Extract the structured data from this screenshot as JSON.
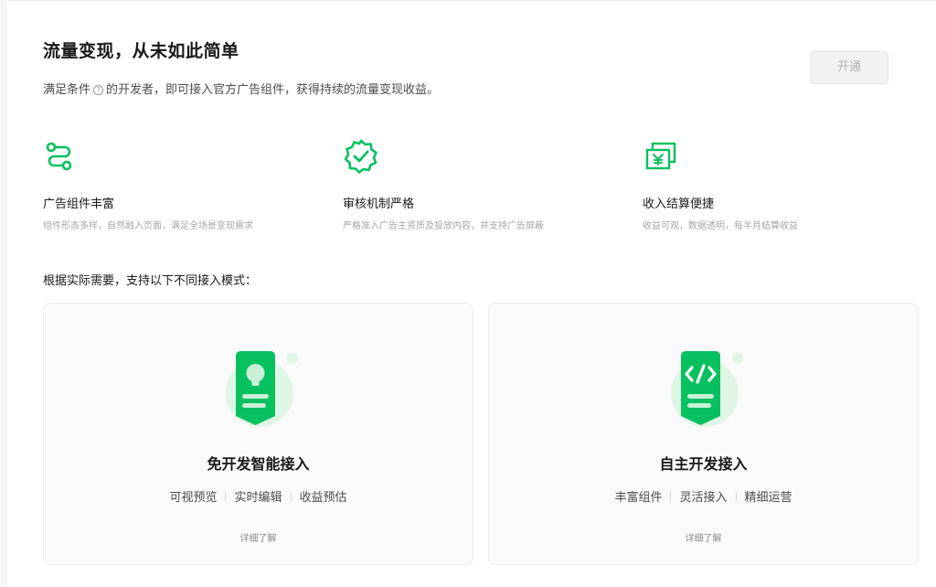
{
  "header": {
    "title": "流量变现，从未如此简单",
    "desc_before": "满足条件",
    "help_glyph": "?",
    "desc_after": "的开发者，即可接入官方广告组件，获得持续的流量变现收益。",
    "open_button": "开通"
  },
  "features": [
    {
      "icon": "route-icon",
      "name": "广告组件丰富",
      "desc": "组件形态多样，自然融入页面，满足全场景变现需求"
    },
    {
      "icon": "verified-badge-icon",
      "name": "审核机制严格",
      "desc": "严格准入广告主资质及投放内容，并支持广告屏蔽"
    },
    {
      "icon": "yen-cards-icon",
      "name": "收入结算便捷",
      "desc": "收益可观，数据透明，每半月结算收益"
    }
  ],
  "modes_label": "根据实际需要，支持以下不同接入模式：",
  "modes": [
    {
      "icon": "lightbulb-doc-icon",
      "title": "免开发智能接入",
      "tags": [
        "可视预览",
        "实时编辑",
        "收益预估"
      ],
      "more": "详细了解"
    },
    {
      "icon": "code-doc-icon",
      "title": "自主开发接入",
      "tags": [
        "丰富组件",
        "灵活接入",
        "精细运营"
      ],
      "more": "详细了解"
    }
  ],
  "colors": {
    "brand_green": "#07c160",
    "light_green": "#dff5e6"
  }
}
